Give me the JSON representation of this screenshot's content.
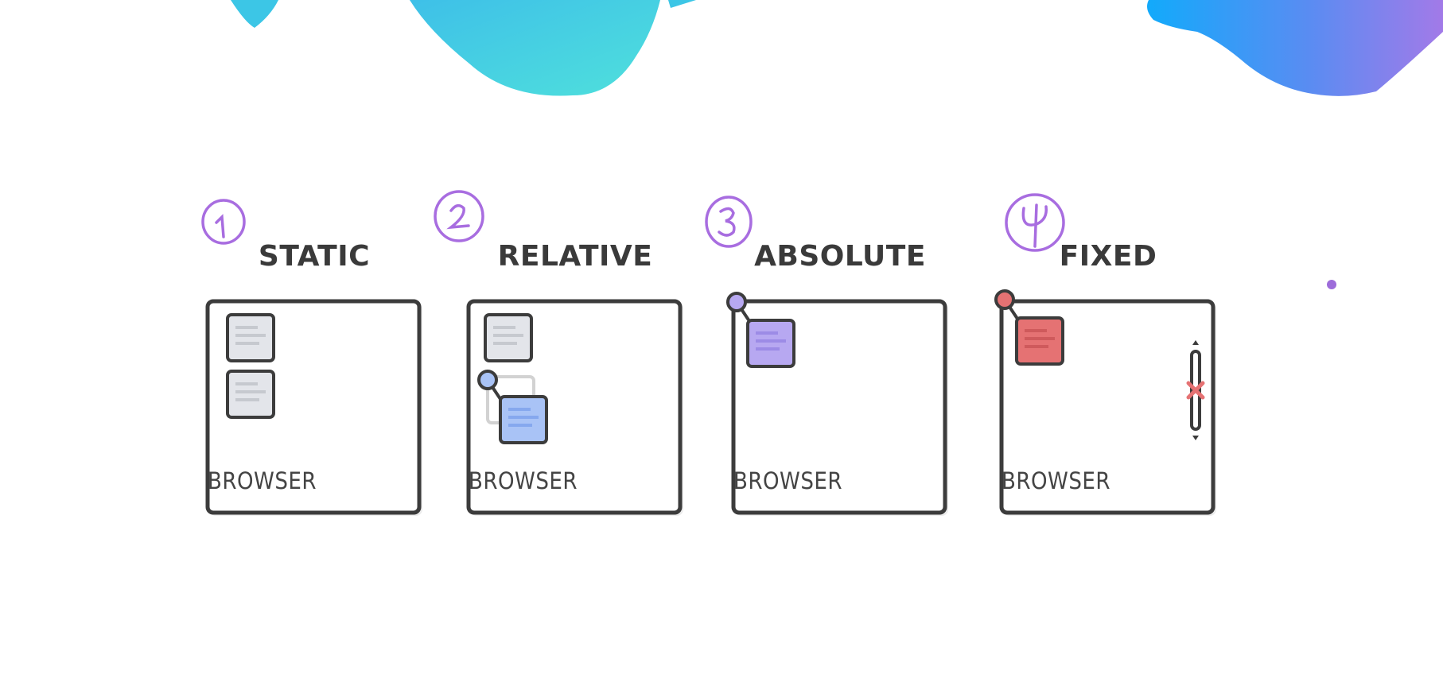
{
  "colors": {
    "outline": "#3c3c3c",
    "static_box": "#e3e5ea",
    "relative_box": "#a9c3f6",
    "absolute_box": "#b7a8f1",
    "fixed_box": "#e57273",
    "annotation_purple": "#a86de0",
    "blob_teal": "#4fd7de",
    "wave_blue": "#17a8fa",
    "wave_purple": "#9d7ae9"
  },
  "panels": [
    {
      "number": "1",
      "title": "STATIC",
      "label": "BROWSER"
    },
    {
      "number": "2",
      "title": "RELATIVE",
      "label": "BROWSER"
    },
    {
      "number": "3",
      "title": "ABSOLUTE",
      "label": "BROWSER"
    },
    {
      "number": "4",
      "title": "FIXED",
      "label": "BROWSER"
    }
  ]
}
